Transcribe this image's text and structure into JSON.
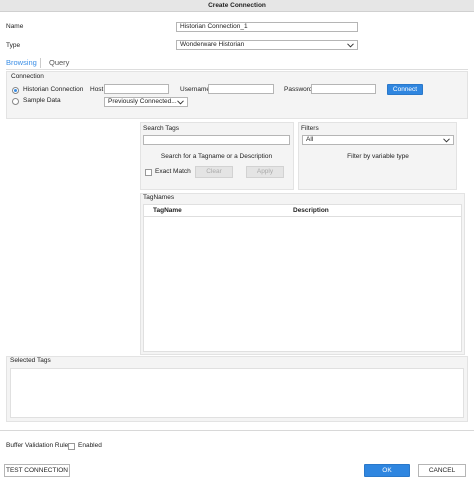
{
  "window": {
    "title": "Create Connection"
  },
  "form": {
    "name_label": "Name",
    "name_value": "Historian Connection_1",
    "type_label": "Type",
    "type_value": "Wonderware Historian"
  },
  "tabs": [
    {
      "label": "Browsing",
      "active": true
    },
    {
      "label": "Query",
      "active": false
    }
  ],
  "connection": {
    "section_label": "Connection",
    "radio_historian": "Historian Connection",
    "radio_sample": "Sample Data",
    "selected": "Historian Connection",
    "host_label": "Host",
    "host_value": "",
    "username_label": "Username",
    "username_value": "",
    "password_label": "Password",
    "password_value": "",
    "connect_label": "Connect",
    "previous_value": "Previously Connected..."
  },
  "search": {
    "label": "Search Tags",
    "value": "",
    "hint": "Search for a Tagname or a Description",
    "exact_match_label": "Exact Match",
    "exact_match_checked": false,
    "clear_label": "Clear",
    "apply_label": "Apply"
  },
  "filters": {
    "label": "Filters",
    "value": "All",
    "hint": "Filter by variable type"
  },
  "tagnames": {
    "label": "TagNames",
    "columns": [
      "TagName",
      "Description"
    ],
    "rows": []
  },
  "selected_tags": {
    "label": "Selected Tags"
  },
  "buffer": {
    "label": "Buffer Validation Rule",
    "enabled_label": "Enabled",
    "enabled_checked": false
  },
  "footer": {
    "test_label": "TEST CONNECTION",
    "ok_label": "OK",
    "cancel_label": "CANCEL"
  },
  "colors": {
    "accent": "#2f86e0",
    "tab_active": "#3a8ee6",
    "panel_bg": "#f4f4f4",
    "titlebar_bg": "#e6e6e6"
  },
  "icons": {
    "dropdown": "chevron-down-icon",
    "radio": "radio-button"
  }
}
